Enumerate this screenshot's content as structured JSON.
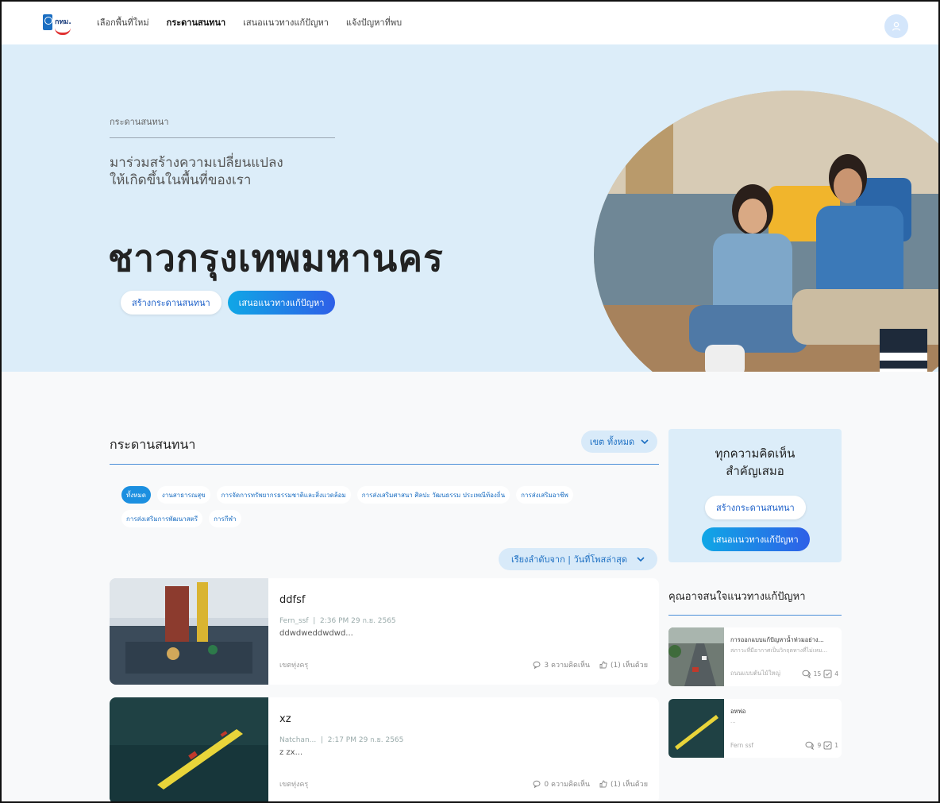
{
  "nav": {
    "logo_text": "กทม.",
    "links": [
      "เลือกพื้นที่ใหม่",
      "กระดานสนทนา",
      "เสนอแนวทางแก้ปัญหา",
      "แจ้งปัญหาที่พบ"
    ],
    "active_index": 1
  },
  "hero": {
    "breadcrumb": "กระดานสนทนา",
    "tagline_line1": "มาร่วมสร้างความเปลี่ยนแปลง",
    "tagline_line2": "ให้เกิดขึ้นในพื้นที่ของเรา",
    "title": "ชาวกรุงเทพมหานคร",
    "btn_create": "สร้างกระดานสนทนา",
    "btn_propose": "เสนอแนวทางแก้ปัญหา"
  },
  "board": {
    "title": "กระดานสนทนา",
    "district_filter": "เขต ทั้งหมด",
    "categories_row1": [
      "ทั้งหมด",
      "งานสาธารณสุข",
      "การจัดการทรัพยากรธรรมชาติและสิ่งแวดล้อม",
      "การส่งเสริมศาสนา ศิลปะ วัฒนธรรม ประเพณีท้องถิ่น",
      "การส่งเสริมอาชีพ"
    ],
    "categories_row2": [
      "การส่งเสริมการพัฒนาสตรี",
      "การกีฬา"
    ],
    "sort_label": "เรียงลำดับจาก | วันที่โพสล่าสุด",
    "posts": [
      {
        "title": "ddfsf",
        "author": "Fern_ssf",
        "datetime": "2:36 PM 29 ก.ย. 2565",
        "desc": "ddwdweddwdwd...",
        "district": "เขตทุ่งครุ",
        "comments": "3 ความคิดเห็น",
        "agree": "(1) เห็นด้วย"
      },
      {
        "title": "xz",
        "author": "Natchan...",
        "datetime": "2:17 PM 29 ก.ย. 2565",
        "desc": "z zx...",
        "district": "เขตทุ่งครุ",
        "comments": "0 ความคิดเห็น",
        "agree": "(1) เห็นด้วย"
      }
    ]
  },
  "sidebar": {
    "cta_line1": "ทุกความคิดเห็น",
    "cta_line2": "สำคัญเสมอ",
    "cta_create": "สร้างกระดานสนทนา",
    "cta_propose": "เสนอแนวทางแก้ปัญหา",
    "rec_title": "คุณอาจสนใจแนวทางแก้ปัญหา",
    "recs": [
      {
        "title": "การออกแบบแก้ปัญหาน้ำท่วมอย่าง...",
        "desc": "สภาวะที่มีอากาศเป็นวิกฤตทางที่ไม่เหม...",
        "author": "ถนนแบบต้นไม้ใหญ่",
        "comments": "15",
        "agree": "4"
      },
      {
        "title": "อหฟอ",
        "desc": "...",
        "author": "Fern ssf",
        "comments": "9",
        "agree": "1"
      }
    ]
  },
  "colors": {
    "accent": "#1b6ec2",
    "hero_bg": "#dcedf9",
    "btn_gradient_start": "#10a7e6",
    "btn_gradient_end": "#2e5fe7"
  }
}
